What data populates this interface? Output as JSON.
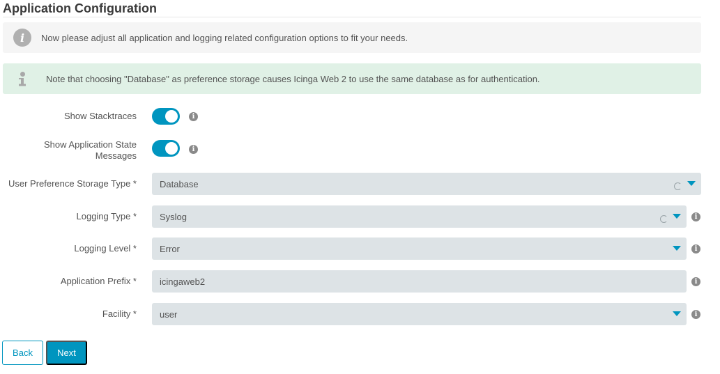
{
  "page": {
    "title": "Application Configuration"
  },
  "notices": {
    "info": "Now please adjust all application and logging related configuration options to fit your needs.",
    "note": "Note that choosing \"Database\" as preference storage causes Icinga Web 2 to use the same database as for authentication."
  },
  "form": {
    "show_stacktraces": {
      "label": "Show Stacktraces",
      "checked": true
    },
    "show_app_state": {
      "label_line1": "Show Application State",
      "label_line2": "Messages",
      "checked": true
    },
    "preference_storage": {
      "label": "User Preference Storage Type *",
      "value": "Database"
    },
    "logging_type": {
      "label": "Logging Type *",
      "value": "Syslog"
    },
    "logging_level": {
      "label": "Logging Level *",
      "value": "Error"
    },
    "app_prefix": {
      "label": "Application Prefix *",
      "value": "icingaweb2"
    },
    "facility": {
      "label": "Facility *",
      "value": "user"
    }
  },
  "buttons": {
    "back": "Back",
    "next": "Next"
  },
  "icons": {
    "help_glyph": "i",
    "info_glyph": "i"
  },
  "colors": {
    "accent": "#0095bf",
    "field_bg": "#dde3e6",
    "note_bg": "#e0f1e6"
  }
}
